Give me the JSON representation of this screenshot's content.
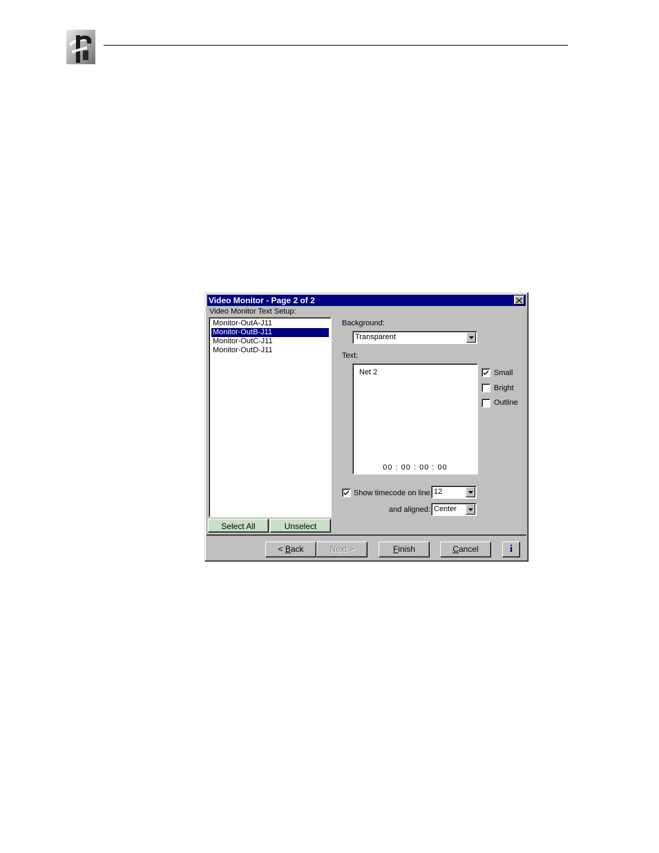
{
  "dialog": {
    "title": "Video Monitor - Page 2 of 2",
    "section_label": "Video Monitor Text Setup:",
    "monitors": [
      {
        "label": "Monitor-OutA-J11",
        "selected": false
      },
      {
        "label": "Monitor-OutB-J11",
        "selected": true
      },
      {
        "label": "Monitor-OutC-J11",
        "selected": false
      },
      {
        "label": "Monitor-OutD-J11",
        "selected": false
      }
    ],
    "select_all_label": "Select All",
    "unselect_label": "Unselect",
    "background_label": "Background:",
    "background_value": "Transparent",
    "text_label": "Text:",
    "text_content": "Net 2",
    "timecode_preview": "00 : 00 : 00 : 00",
    "options": [
      {
        "label": "Small",
        "checked": true
      },
      {
        "label": "Bright",
        "checked": false
      },
      {
        "label": "Outline",
        "checked": false
      }
    ],
    "show_timecode_label": "Show timecode on line:",
    "show_timecode_checked": true,
    "timecode_line_value": "12",
    "aligned_label": "and aligned:",
    "aligned_value": "Center",
    "buttons": {
      "back_prefix": "< ",
      "back_key": "B",
      "back_rest": "ack",
      "next": "Next >",
      "finish_key": "F",
      "finish_rest": "inish",
      "cancel_key": "C",
      "cancel_rest": "ancel",
      "info": "i"
    }
  },
  "colors": {
    "titlebar": "#000080",
    "dialog_face": "#c0c0c0",
    "selection": "#000080",
    "select_button_face": "#c8e0c8",
    "info_icon": "#000080"
  },
  "icons": [
    "logo-icon",
    "close-icon",
    "dropdown-arrow-icon",
    "checkmark-icon",
    "info-icon"
  ]
}
